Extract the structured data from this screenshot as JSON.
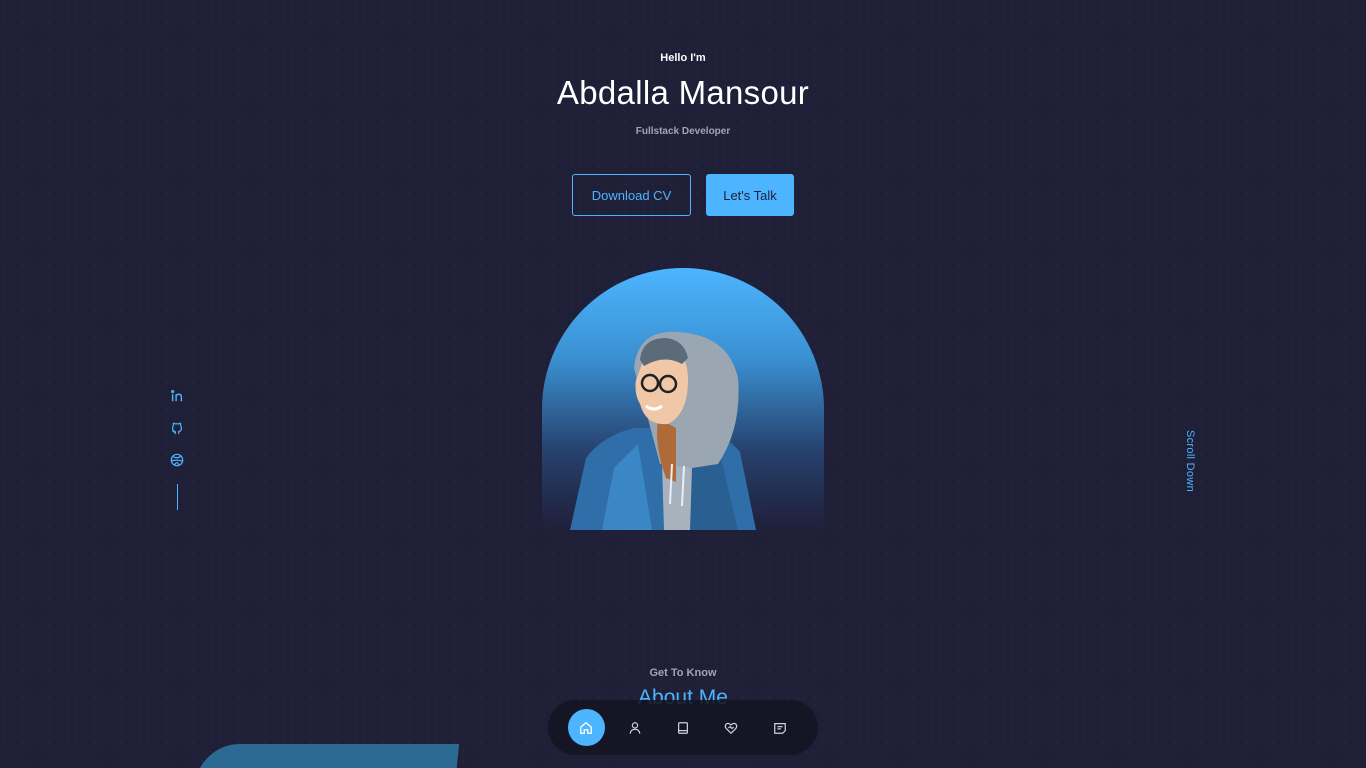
{
  "hero": {
    "greeting": "Hello I'm",
    "name": "Abdalla Mansour",
    "role": "Fullstack Developer",
    "download_cv_label": "Download CV",
    "lets_talk_label": "Let's Talk"
  },
  "socials": [
    "linkedin-icon",
    "github-icon",
    "dribbble-icon"
  ],
  "scroll_down_label": "Scroll Down",
  "about": {
    "subtitle": "Get To Know",
    "title": "About Me"
  },
  "nav": {
    "items": [
      "home-icon",
      "user-icon",
      "book-icon",
      "services-icon",
      "messages-icon"
    ],
    "active_index": 0
  },
  "colors": {
    "background": "#1f1f38",
    "accent": "#4db5ff",
    "text_light": "#a3a3b8",
    "nav_bg": "#141422"
  }
}
